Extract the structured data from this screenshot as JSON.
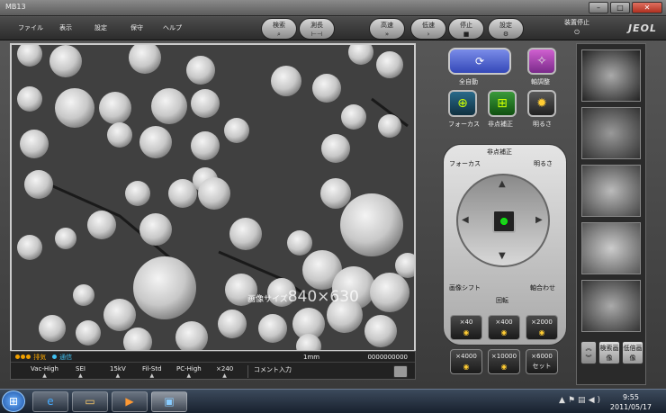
{
  "window": {
    "title": "MB13"
  },
  "menu": [
    "ファイル",
    "表示",
    "設定",
    "保守",
    "ヘルプ"
  ],
  "toolbar": {
    "search": "検索",
    "measure": "測長",
    "high_speed": "高速",
    "low_speed": "低速",
    "stop": "停止",
    "settings": "設定",
    "device_stop": "装置停止"
  },
  "logo": "JEOL",
  "viewer": {
    "image_size_label": "画像サイズ",
    "image_size_value": "840×630"
  },
  "status": {
    "indicators": [
      {
        "label": "排気",
        "color": "#f0a000"
      },
      {
        "label": "通信",
        "color": "#40c0f0"
      }
    ],
    "scale": "1mm",
    "counter": "0000000000",
    "params": [
      "Vac-High",
      "SEI",
      "15kV",
      "Fil-Std",
      "PC-High",
      "×240"
    ],
    "comment": "コメント入力"
  },
  "controls": {
    "auto": "全自動",
    "axis_adjust": "軸調整",
    "focus": "フォーカス",
    "astig": "非点補正",
    "brightness": "明るさ",
    "pad": {
      "astig": "非点補正",
      "focus": "フォーカス",
      "brightness": "明るさ",
      "image_shift": "画像シフト",
      "rotate": "回転",
      "axis_align": "軸合わせ"
    },
    "mag": [
      "×40",
      "×400",
      "×2000",
      "×4000",
      "×10000",
      "×6000"
    ],
    "mag_set": "セット"
  },
  "thumbnails": {
    "search_image": "検索画像",
    "low_mag_image": "低倍画像"
  },
  "taskbar": {
    "time": "9:55",
    "date": "2011/05/17"
  }
}
